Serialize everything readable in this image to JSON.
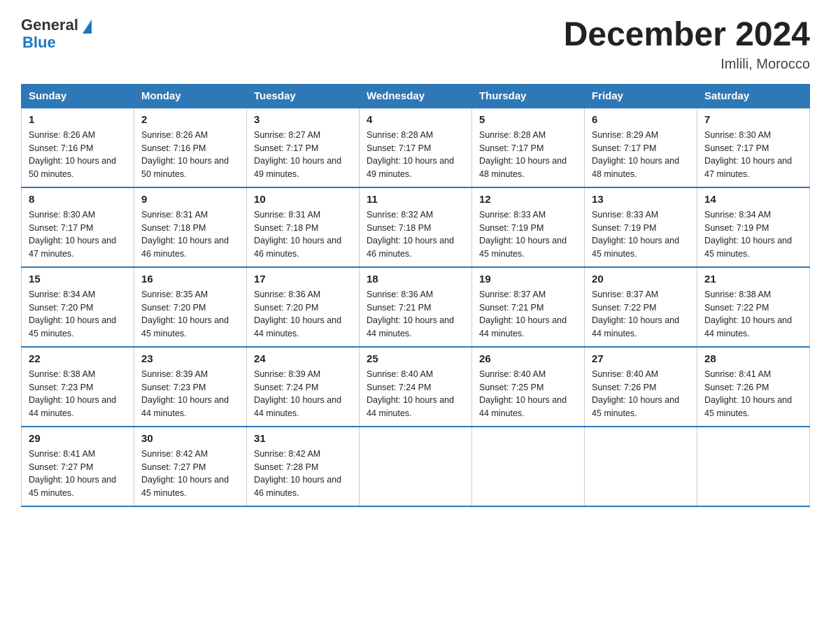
{
  "logo": {
    "general": "General",
    "blue": "Blue"
  },
  "title": {
    "month_year": "December 2024",
    "location": "Imlili, Morocco"
  },
  "weekdays": [
    "Sunday",
    "Monday",
    "Tuesday",
    "Wednesday",
    "Thursday",
    "Friday",
    "Saturday"
  ],
  "weeks": [
    [
      {
        "day": "1",
        "sunrise": "8:26 AM",
        "sunset": "7:16 PM",
        "daylight": "10 hours and 50 minutes."
      },
      {
        "day": "2",
        "sunrise": "8:26 AM",
        "sunset": "7:16 PM",
        "daylight": "10 hours and 50 minutes."
      },
      {
        "day": "3",
        "sunrise": "8:27 AM",
        "sunset": "7:17 PM",
        "daylight": "10 hours and 49 minutes."
      },
      {
        "day": "4",
        "sunrise": "8:28 AM",
        "sunset": "7:17 PM",
        "daylight": "10 hours and 49 minutes."
      },
      {
        "day": "5",
        "sunrise": "8:28 AM",
        "sunset": "7:17 PM",
        "daylight": "10 hours and 48 minutes."
      },
      {
        "day": "6",
        "sunrise": "8:29 AM",
        "sunset": "7:17 PM",
        "daylight": "10 hours and 48 minutes."
      },
      {
        "day": "7",
        "sunrise": "8:30 AM",
        "sunset": "7:17 PM",
        "daylight": "10 hours and 47 minutes."
      }
    ],
    [
      {
        "day": "8",
        "sunrise": "8:30 AM",
        "sunset": "7:17 PM",
        "daylight": "10 hours and 47 minutes."
      },
      {
        "day": "9",
        "sunrise": "8:31 AM",
        "sunset": "7:18 PM",
        "daylight": "10 hours and 46 minutes."
      },
      {
        "day": "10",
        "sunrise": "8:31 AM",
        "sunset": "7:18 PM",
        "daylight": "10 hours and 46 minutes."
      },
      {
        "day": "11",
        "sunrise": "8:32 AM",
        "sunset": "7:18 PM",
        "daylight": "10 hours and 46 minutes."
      },
      {
        "day": "12",
        "sunrise": "8:33 AM",
        "sunset": "7:19 PM",
        "daylight": "10 hours and 45 minutes."
      },
      {
        "day": "13",
        "sunrise": "8:33 AM",
        "sunset": "7:19 PM",
        "daylight": "10 hours and 45 minutes."
      },
      {
        "day": "14",
        "sunrise": "8:34 AM",
        "sunset": "7:19 PM",
        "daylight": "10 hours and 45 minutes."
      }
    ],
    [
      {
        "day": "15",
        "sunrise": "8:34 AM",
        "sunset": "7:20 PM",
        "daylight": "10 hours and 45 minutes."
      },
      {
        "day": "16",
        "sunrise": "8:35 AM",
        "sunset": "7:20 PM",
        "daylight": "10 hours and 45 minutes."
      },
      {
        "day": "17",
        "sunrise": "8:36 AM",
        "sunset": "7:20 PM",
        "daylight": "10 hours and 44 minutes."
      },
      {
        "day": "18",
        "sunrise": "8:36 AM",
        "sunset": "7:21 PM",
        "daylight": "10 hours and 44 minutes."
      },
      {
        "day": "19",
        "sunrise": "8:37 AM",
        "sunset": "7:21 PM",
        "daylight": "10 hours and 44 minutes."
      },
      {
        "day": "20",
        "sunrise": "8:37 AM",
        "sunset": "7:22 PM",
        "daylight": "10 hours and 44 minutes."
      },
      {
        "day": "21",
        "sunrise": "8:38 AM",
        "sunset": "7:22 PM",
        "daylight": "10 hours and 44 minutes."
      }
    ],
    [
      {
        "day": "22",
        "sunrise": "8:38 AM",
        "sunset": "7:23 PM",
        "daylight": "10 hours and 44 minutes."
      },
      {
        "day": "23",
        "sunrise": "8:39 AM",
        "sunset": "7:23 PM",
        "daylight": "10 hours and 44 minutes."
      },
      {
        "day": "24",
        "sunrise": "8:39 AM",
        "sunset": "7:24 PM",
        "daylight": "10 hours and 44 minutes."
      },
      {
        "day": "25",
        "sunrise": "8:40 AM",
        "sunset": "7:24 PM",
        "daylight": "10 hours and 44 minutes."
      },
      {
        "day": "26",
        "sunrise": "8:40 AM",
        "sunset": "7:25 PM",
        "daylight": "10 hours and 44 minutes."
      },
      {
        "day": "27",
        "sunrise": "8:40 AM",
        "sunset": "7:26 PM",
        "daylight": "10 hours and 45 minutes."
      },
      {
        "day": "28",
        "sunrise": "8:41 AM",
        "sunset": "7:26 PM",
        "daylight": "10 hours and 45 minutes."
      }
    ],
    [
      {
        "day": "29",
        "sunrise": "8:41 AM",
        "sunset": "7:27 PM",
        "daylight": "10 hours and 45 minutes."
      },
      {
        "day": "30",
        "sunrise": "8:42 AM",
        "sunset": "7:27 PM",
        "daylight": "10 hours and 45 minutes."
      },
      {
        "day": "31",
        "sunrise": "8:42 AM",
        "sunset": "7:28 PM",
        "daylight": "10 hours and 46 minutes."
      },
      null,
      null,
      null,
      null
    ]
  ],
  "labels": {
    "sunrise": "Sunrise:",
    "sunset": "Sunset:",
    "daylight": "Daylight:"
  }
}
